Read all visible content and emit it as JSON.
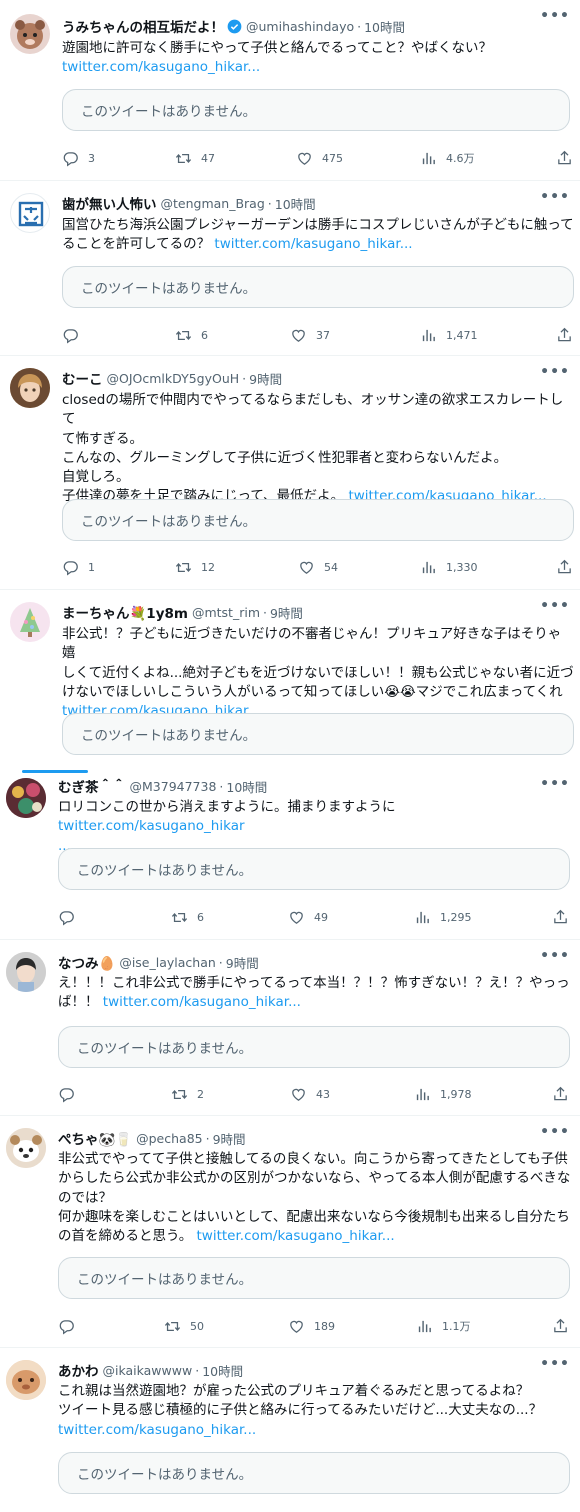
{
  "colors": {
    "link": "#1d9bf0",
    "muted": "#536471",
    "text": "#0f1419",
    "quote_bg": "#f7f9f9",
    "verified": "#1d9bf0"
  },
  "icons": {
    "reply": "reply-icon",
    "retweet": "retweet-icon",
    "like": "heart-icon",
    "views": "views-icon",
    "share": "share-icon",
    "more": "more-icon"
  },
  "tweets": [
    {
      "name": "うみちゃんの相互垢だよ！",
      "handle": "@umihashindayo",
      "dot": "·",
      "time": "10時間",
      "verified": true,
      "text_lines": [
        "遊園地に許可なく勝手にやって子供と絡んでるってこと？やばくない？"
      ],
      "link": "twitter.com/kasugano_hikar...",
      "quote": "このツイートはありません。",
      "replies": "3",
      "retweets": "47",
      "likes": "475",
      "views": "4.6万"
    },
    {
      "name": "歯が無い人怖い",
      "handle": "@tengman_Brag",
      "dot": "·",
      "time": "10時間",
      "text_lines": [
        "国営ひたち海浜公園プレジャーガーデンは勝手にコスプレじいさんが子どもに触って",
        "ることを許可してるの？"
      ],
      "link": "twitter.com/kasugano_hikar...",
      "quote": "このツイートはありません。",
      "replies": "",
      "retweets": "6",
      "likes": "37",
      "views": "1,471"
    },
    {
      "name": "むーこ",
      "handle": "@OJOcmlkDY5gyOuH",
      "dot": "·",
      "time": "9時間",
      "text_lines": [
        "closedの場所で仲間内でやってるならまだしも、オッサン達の欲求エスカレートして",
        "て怖すぎる。",
        "こんなの、グルーミングして子供に近づく性犯罪者と変わらないんだよ。",
        "自覚しろ。",
        "子供達の夢を土足で踏みにじって、最低だよ。"
      ],
      "link": "twitter.com/kasugano_hikar...",
      "quote": "このツイートはありません。",
      "replies": "1",
      "retweets": "12",
      "likes": "54",
      "views": "1,330"
    },
    {
      "name": "まーちゃん💐1y8m",
      "handle": "@mtst_rim",
      "dot": "·",
      "time": "9時間",
      "text_lines": [
        "非公式！？子どもに近づきたいだけの不審者じゃん！プリキュア好きな子はそりゃ嬉",
        "しくて近付くよね...絶対子どもを近づけないでほしい！！親も公式じゃない者に近づ",
        "けないでほしいしこういう人がいるって知ってほしい😭😭マジでこれ広まってくれ"
      ],
      "link": "twitter.com/kasugano_hikar...",
      "quote": "このツイートはありません。",
      "replies": "",
      "retweets": "",
      "likes": "",
      "views": ""
    },
    {
      "name": "むぎ茶＾＾",
      "handle": "@M37947738",
      "dot": "·",
      "time": "10時間",
      "text_lines": [
        "ロリコンこの世から消えますように。捕まりますように"
      ],
      "link": "twitter.com/kasugano_hikar",
      "link2": "...",
      "quote": "このツイートはありません。",
      "replies": "",
      "retweets": "6",
      "likes": "49",
      "views": "1,295"
    },
    {
      "name": "なつみ🥚",
      "handle": "@ise_laylachan",
      "dot": "·",
      "time": "9時間",
      "text_lines": [
        "え！！！これ非公式で勝手にやってるって本当！？！？怖すぎない！？え！？やっっ",
        "ば！！"
      ],
      "link": "twitter.com/kasugano_hikar...",
      "quote": "このツイートはありません。",
      "replies": "",
      "retweets": "2",
      "likes": "43",
      "views": "1,978"
    },
    {
      "name": "ぺちゃ🐼🥛",
      "handle": "@pecha85",
      "dot": "·",
      "time": "9時間",
      "text_lines": [
        "非公式でやってて子供と接触してるの良くない。向こうから寄ってきたとしても子供",
        "からしたら公式か非公式かの区別がつかないなら、やってる本人側が配慮するべきな",
        "のでは？",
        "何か趣味を楽しむことはいいとして、配慮出来ないなら今後規制も出来るし自分たち",
        "の首を締めると思う。"
      ],
      "link": "twitter.com/kasugano_hikar...",
      "quote": "このツイートはありません。",
      "replies": "",
      "retweets": "50",
      "likes": "189",
      "views": "1.1万"
    },
    {
      "name": "あかわ",
      "handle": "@ikaikawwww",
      "dot": "·",
      "time": "10時間",
      "text_lines": [
        "これ親は当然遊園地？が雇った公式のプリキュア着ぐるみだと思ってるよね？",
        "ツイート見る感じ積極的に子供と絡みに行ってるみたいだけど...大丈夫なの...？"
      ],
      "link": "twitter.com/kasugano_hikar...",
      "quote": "このツイートはありません。"
    }
  ]
}
